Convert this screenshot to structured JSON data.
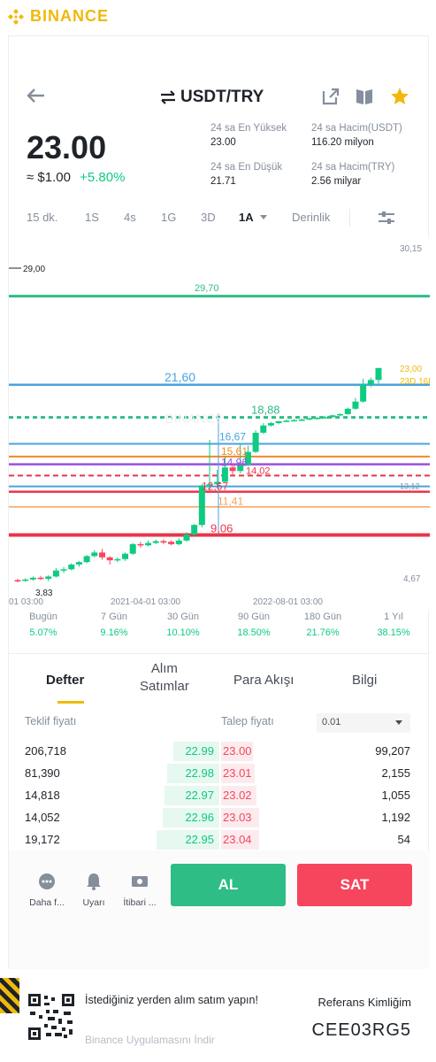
{
  "brand": {
    "name": "BINANCE",
    "color": "#f0b90b"
  },
  "header": {
    "pair": "USDT/TRY",
    "icons": [
      "back-arrow-icon",
      "swap-icon",
      "external-link-icon",
      "split-view-icon",
      "star-icon"
    ]
  },
  "price": {
    "last": "23.00",
    "usd": "≈ $1.00",
    "change": "+5.80%"
  },
  "stats": {
    "high_label": "24 sa En Yüksek",
    "high": "23.00",
    "low_label": "24 sa En Düşük",
    "low": "21.71",
    "vol_usdt_label": "24 sa Hacim(USDT)",
    "vol_usdt": "116.20 milyon",
    "vol_try_label": "24 sa Hacim(TRY)",
    "vol_try": "2.56 milyar"
  },
  "timeframes": [
    "15 dk.",
    "1S",
    "4s",
    "1G",
    "3D",
    "1A",
    "Derinlik"
  ],
  "active_timeframe": "1A",
  "chart": {
    "labels": {
      "top_right": "30,15",
      "left_level": "29,00",
      "level_2160": "21,60",
      "level_1888": "18,88",
      "level_1667": "16,67",
      "level_1561": "15,61",
      "level_1496": "14,96",
      "level_1402": "14,02",
      "level_1267": "12,67",
      "level_1141": "11,41",
      "level_906": "9,06",
      "last_price": "23,00",
      "countdown": "23D 16H",
      "right_small": "13,12",
      "low_label": "3,83",
      "bottom_right": "4,67",
      "top_cut": "29,70"
    },
    "x_ticks": [
      "01 03:00",
      "2021-04-01 03:00",
      "2022-08-01 03:00"
    ]
  },
  "chart_data": {
    "type": "candlestick",
    "interval": "1A",
    "x_ticks": [
      "01 03:00",
      "2021-04-01 03:00",
      "2022-08-01 03:00"
    ],
    "ylim": [
      4.67,
      30.15
    ],
    "horizontal_levels": [
      29.0,
      21.6,
      18.88,
      16.67,
      15.61,
      14.96,
      14.02,
      13.12,
      12.67,
      11.41,
      9.06
    ],
    "last_price": 23.0,
    "candles": [
      {
        "o": 5.3,
        "c": 5.25,
        "h": 5.4,
        "l": 5.1
      },
      {
        "o": 5.25,
        "c": 5.35,
        "h": 5.45,
        "l": 5.15
      },
      {
        "o": 5.35,
        "c": 5.5,
        "h": 5.6,
        "l": 5.25
      },
      {
        "o": 5.5,
        "c": 5.4,
        "h": 5.65,
        "l": 5.3
      },
      {
        "o": 5.4,
        "c": 5.6,
        "h": 5.7,
        "l": 5.2
      },
      {
        "o": 5.6,
        "c": 6.1,
        "h": 6.3,
        "l": 5.5
      },
      {
        "o": 6.1,
        "c": 6.2,
        "h": 6.4,
        "l": 5.9
      },
      {
        "o": 6.2,
        "c": 6.6,
        "h": 6.7,
        "l": 6.1
      },
      {
        "o": 6.6,
        "c": 6.8,
        "h": 6.9,
        "l": 6.4
      },
      {
        "o": 6.8,
        "c": 7.3,
        "h": 7.4,
        "l": 6.7
      },
      {
        "o": 7.3,
        "c": 7.6,
        "h": 7.8,
        "l": 7.2
      },
      {
        "o": 7.6,
        "c": 7.2,
        "h": 7.9,
        "l": 7.0
      },
      {
        "o": 7.2,
        "c": 6.95,
        "h": 7.3,
        "l": 6.6
      },
      {
        "o": 6.95,
        "c": 7.05,
        "h": 7.2,
        "l": 6.8
      },
      {
        "o": 7.05,
        "c": 7.5,
        "h": 7.6,
        "l": 6.9
      },
      {
        "o": 7.5,
        "c": 8.3,
        "h": 8.4,
        "l": 7.4
      },
      {
        "o": 8.3,
        "c": 8.2,
        "h": 8.5,
        "l": 8.0
      },
      {
        "o": 8.2,
        "c": 8.4,
        "h": 8.6,
        "l": 8.1
      },
      {
        "o": 8.4,
        "c": 8.55,
        "h": 8.7,
        "l": 8.3
      },
      {
        "o": 8.55,
        "c": 8.5,
        "h": 8.7,
        "l": 8.3
      },
      {
        "o": 8.5,
        "c": 8.3,
        "h": 8.6,
        "l": 8.2
      },
      {
        "o": 8.3,
        "c": 8.6,
        "h": 8.8,
        "l": 8.2
      },
      {
        "o": 8.6,
        "c": 9.1,
        "h": 9.3,
        "l": 8.5
      },
      {
        "o": 9.1,
        "c": 9.9,
        "h": 10.0,
        "l": 9.0
      },
      {
        "o": 9.9,
        "c": 13.2,
        "h": 13.3,
        "l": 9.7
      },
      {
        "o": 13.2,
        "c": 13.3,
        "h": 17.0,
        "l": 12.8
      },
      {
        "o": 13.3,
        "c": 13.5,
        "h": 14.5,
        "l": 13.1
      },
      {
        "o": 13.5,
        "c": 14.7,
        "h": 15.6,
        "l": 13.4
      },
      {
        "o": 14.7,
        "c": 14.4,
        "h": 15.0,
        "l": 14.0
      },
      {
        "o": 14.4,
        "c": 14.9,
        "h": 16.6,
        "l": 14.2
      },
      {
        "o": 14.9,
        "c": 16.0,
        "h": 16.5,
        "l": 14.8
      },
      {
        "o": 16.0,
        "c": 17.6,
        "h": 17.8,
        "l": 15.9
      },
      {
        "o": 17.6,
        "c": 18.2,
        "h": 18.4,
        "l": 17.5
      },
      {
        "o": 18.2,
        "c": 18.4,
        "h": 18.5,
        "l": 18.1
      },
      {
        "o": 18.4,
        "c": 18.55,
        "h": 18.6,
        "l": 18.3
      },
      {
        "o": 18.55,
        "c": 18.6,
        "h": 18.7,
        "l": 18.5
      },
      {
        "o": 18.6,
        "c": 18.65,
        "h": 18.75,
        "l": 18.55
      },
      {
        "o": 18.65,
        "c": 18.7,
        "h": 18.8,
        "l": 18.6
      },
      {
        "o": 18.7,
        "c": 18.8,
        "h": 18.88,
        "l": 18.65
      },
      {
        "o": 18.8,
        "c": 18.85,
        "h": 18.9,
        "l": 18.7
      },
      {
        "o": 18.85,
        "c": 18.9,
        "h": 19.0,
        "l": 18.8
      },
      {
        "o": 18.9,
        "c": 19.05,
        "h": 19.1,
        "l": 18.85
      },
      {
        "o": 19.05,
        "c": 19.15,
        "h": 19.2,
        "l": 19.0
      },
      {
        "o": 19.15,
        "c": 19.6,
        "h": 19.7,
        "l": 19.1
      },
      {
        "o": 19.6,
        "c": 20.2,
        "h": 20.5,
        "l": 19.5
      },
      {
        "o": 20.2,
        "c": 21.6,
        "h": 22.1,
        "l": 20.1
      },
      {
        "o": 21.6,
        "c": 22.0,
        "h": 22.2,
        "l": 21.4
      },
      {
        "o": 22.0,
        "c": 23.0,
        "h": 23.0,
        "l": 21.71
      }
    ],
    "colors": {
      "up": "#0ecb81",
      "down": "#f6465d"
    }
  },
  "performance": [
    {
      "label": "Bugün",
      "value": "5.07%"
    },
    {
      "label": "7 Gün",
      "value": "9.16%"
    },
    {
      "label": "30 Gün",
      "value": "10.10%"
    },
    {
      "label": "90 Gün",
      "value": "18.50%"
    },
    {
      "label": "180 Gün",
      "value": "21.76%"
    },
    {
      "label": "1 Yıl",
      "value": "38.15%"
    }
  ],
  "tabs": {
    "defter": "Defter",
    "alim_line1": "Alım",
    "alim_line2": "Satımlar",
    "para": "Para Akışı",
    "bilgi": "Bilgi"
  },
  "orderbook": {
    "bid_label": "Teklif fiyatı",
    "ask_label": "Talep fiyatı",
    "precision": "0.01",
    "rows": [
      {
        "bid_qty": "206,718",
        "bid": "22.99",
        "ask": "23.00",
        "ask_qty": "99,207",
        "bid_depth": 0.22,
        "ask_depth": 0.15
      },
      {
        "bid_qty": "81,390",
        "bid": "22.98",
        "ask": "23.01",
        "ask_qty": "2,155",
        "bid_depth": 0.25,
        "ask_depth": 0.16
      },
      {
        "bid_qty": "14,818",
        "bid": "22.97",
        "ask": "23.02",
        "ask_qty": "1,055",
        "bid_depth": 0.26,
        "ask_depth": 0.17
      },
      {
        "bid_qty": "14,052",
        "bid": "22.96",
        "ask": "23.03",
        "ask_qty": "1,192",
        "bid_depth": 0.27,
        "ask_depth": 0.18
      },
      {
        "bid_qty": "19,172",
        "bid": "22.95",
        "ask": "23.04",
        "ask_qty": "54",
        "bid_depth": 0.3,
        "ask_depth": 0.18
      }
    ]
  },
  "actions": {
    "more": "Daha f...",
    "alert": "Uyarı",
    "margin": "İtibari ...",
    "buy": "AL",
    "sell": "SAT"
  },
  "footer": {
    "line1": "İstediğiniz yerden alım satım yapın!",
    "line2": "Binance Uygulamasını İndir",
    "ref_label": "Referans Kimliğim",
    "ref_code": "CEE03RG5"
  }
}
